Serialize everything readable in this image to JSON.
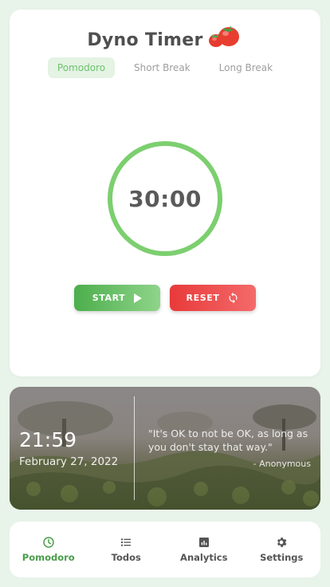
{
  "app": {
    "title": "Dyno Timer",
    "logo_icon": "tomato-icon"
  },
  "tabs": [
    {
      "label": "Pomodoro",
      "active": true
    },
    {
      "label": "Short Break",
      "active": false
    },
    {
      "label": "Long Break",
      "active": false
    }
  ],
  "timer": {
    "time_left": "30:00",
    "progress": 1.0,
    "ring_color": "#7ccf6f"
  },
  "controls": {
    "start_label": "START",
    "start_icon": "play-icon",
    "reset_label": "RESET",
    "reset_icon": "refresh-icon"
  },
  "clock": {
    "time": "21:59",
    "date": "February 27, 2022",
    "quote": "\"It's OK to not be OK, as long as you don't stay that way.\"",
    "author": "- Anonymous"
  },
  "nav": [
    {
      "label": "Pomodoro",
      "icon": "clock-icon",
      "active": true
    },
    {
      "label": "Todos",
      "icon": "list-icon",
      "active": false
    },
    {
      "label": "Analytics",
      "icon": "analytics-icon",
      "active": false
    },
    {
      "label": "Settings",
      "icon": "gear-icon",
      "active": false
    }
  ],
  "colors": {
    "accent_green": "#4a9d4a",
    "start_button": "#4cae4c",
    "reset_button": "#e83a3a",
    "background": "#e8f3ea"
  }
}
